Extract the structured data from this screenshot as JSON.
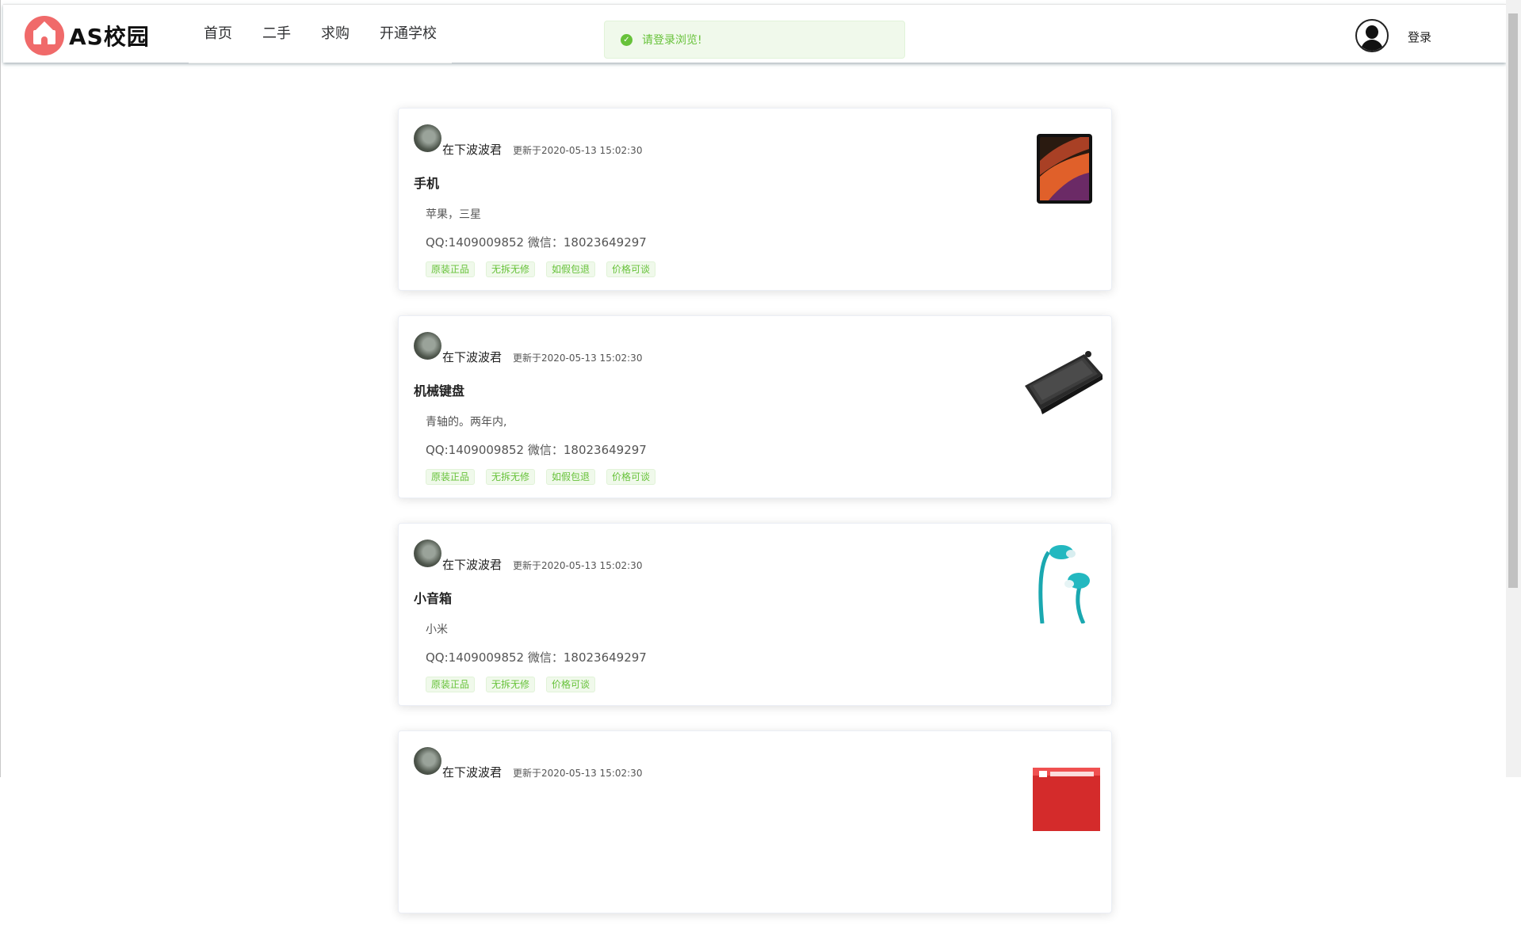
{
  "header": {
    "logo_text": "AS校园",
    "nav": [
      "首页",
      "二手",
      "求购",
      "开通学校"
    ],
    "login_label": "登录"
  },
  "toast": {
    "message": "请登录浏览!",
    "icon": "check-circle-icon",
    "color": "#67c23a"
  },
  "posts": [
    {
      "author": "在下波波君",
      "time": "更新于2020-05-13 15:02:30",
      "title": "手机",
      "desc": "苹果，三星",
      "contact": "QQ:1409009852 微信：18023649297",
      "tags": [
        "原装正品",
        "无拆无修",
        "如假包退",
        "价格可谈"
      ],
      "image": "phone"
    },
    {
      "author": "在下波波君",
      "time": "更新于2020-05-13 15:02:30",
      "title": "机械键盘",
      "desc": "青轴的。两年内,",
      "contact": "QQ:1409009852 微信：18023649297",
      "tags": [
        "原装正品",
        "无拆无修",
        "如假包退",
        "价格可谈"
      ],
      "image": "keyboard"
    },
    {
      "author": "在下波波君",
      "time": "更新于2020-05-13 15:02:30",
      "title": "小音箱",
      "desc": "小米",
      "contact": "QQ:1409009852 微信：18023649297",
      "tags": [
        "原装正品",
        "无拆无修",
        "价格可谈"
      ],
      "image": "earphones"
    },
    {
      "author": "在下波波君",
      "time": "更新于2020-05-13 15:02:30",
      "title": "",
      "desc": "",
      "contact": "",
      "tags": [],
      "image": "book-box"
    }
  ]
}
